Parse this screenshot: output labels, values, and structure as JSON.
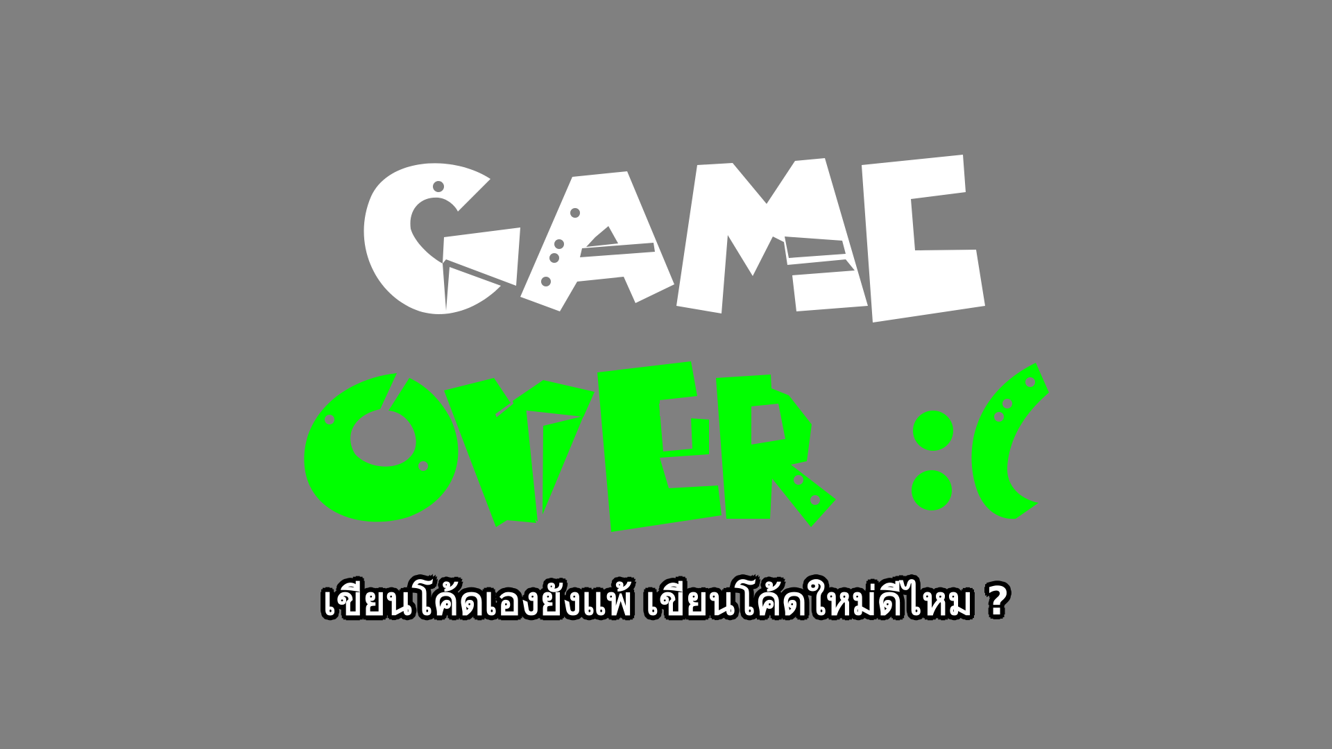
{
  "screen": {
    "background_color": "#808080"
  },
  "title": {
    "line1": "GAME",
    "line2": "OVER :(",
    "line1_color": "#ffffff",
    "line2_color": "#00ff00",
    "style": "cut-paper stencil lettering with holes"
  },
  "subtitle": {
    "text": "เขียนโค้ดเองยังแพ้ เขียนโค้ดใหม่ดีไหม ?",
    "text_color": "#ffffff",
    "outline_color": "#000000"
  }
}
